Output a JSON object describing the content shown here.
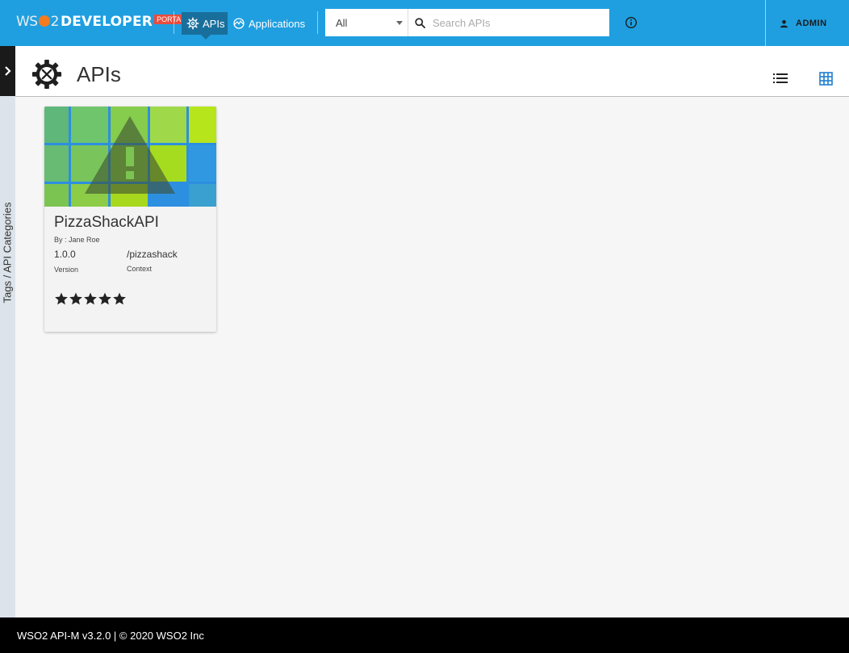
{
  "header": {
    "logo": {
      "brand": "WSO2",
      "product": "DEVELOPER",
      "badge": "PORTAL"
    },
    "nav": [
      {
        "label": "APIs",
        "icon": "gear-icon",
        "active": true
      },
      {
        "label": "Applications",
        "icon": "applications-icon",
        "active": false
      }
    ],
    "search": {
      "filter_value": "All",
      "placeholder": "Search APIs"
    },
    "user": {
      "label": "ADMIN",
      "icon": "person-icon"
    },
    "colors": {
      "bar": "#1f9fe0",
      "active_nav": "#196f9c",
      "badge": "#e84c3d",
      "logo_dot": "#f47b20"
    }
  },
  "drawer": {
    "label": "Tags / API Categories"
  },
  "page": {
    "title": "APIs",
    "view_modes": [
      "list-view-icon",
      "grid-view-icon"
    ]
  },
  "apis": [
    {
      "name": "PizzaShackAPI",
      "by": "By : Jane Roe",
      "version": "1.0.0",
      "version_label": "Version",
      "context": "/pizzashack",
      "context_label": "Context",
      "rating": 5,
      "max_rating": 5
    }
  ],
  "footer": {
    "text": "WSO2 API-M v3.2.0 | © 2020 WSO2 Inc"
  }
}
